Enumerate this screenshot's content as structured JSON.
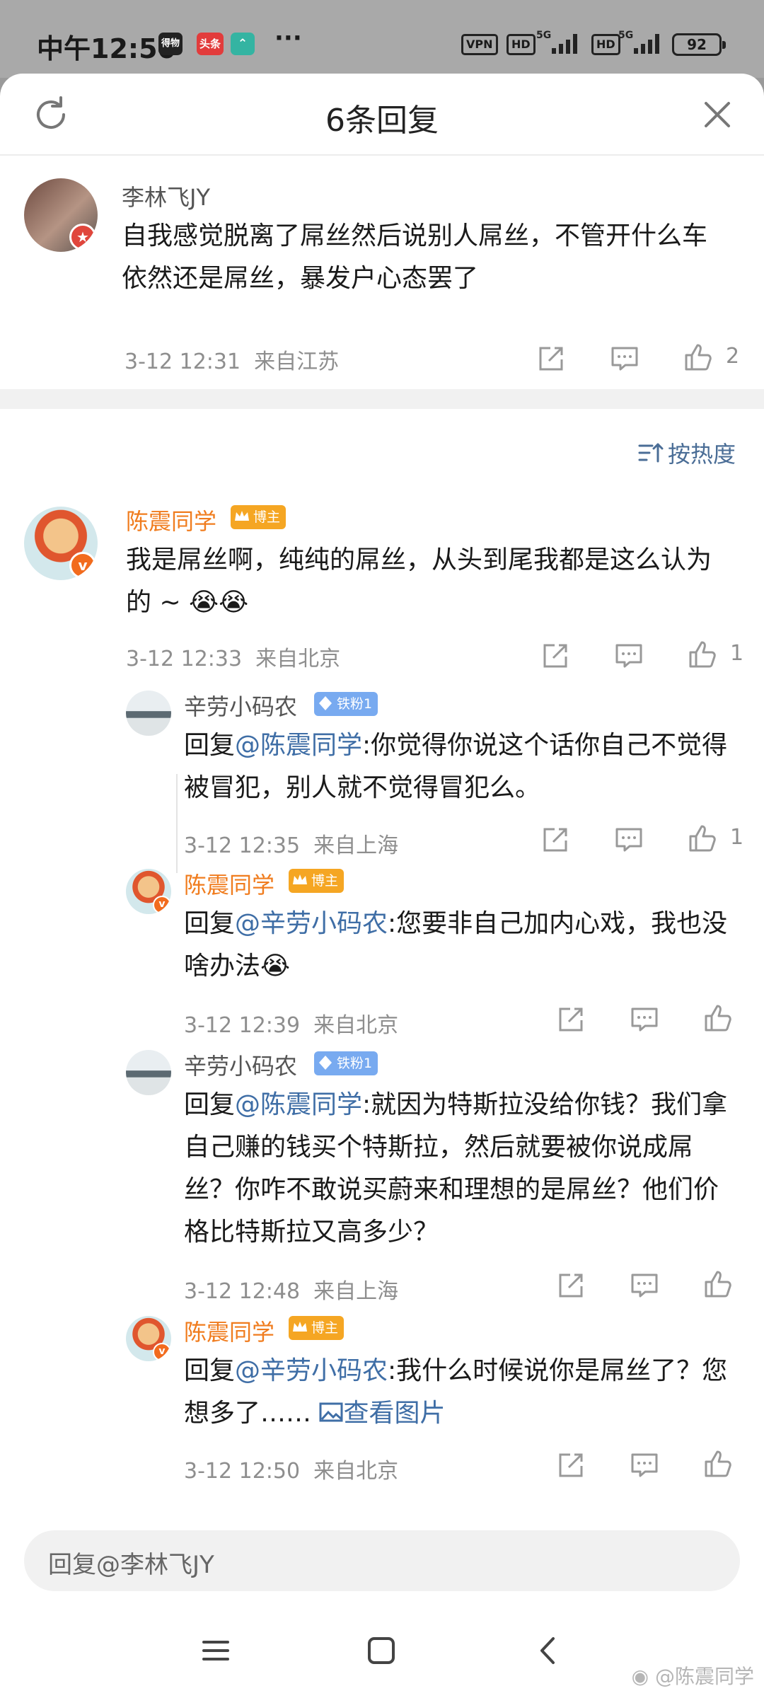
{
  "status_bar": {
    "time": "中午12:50",
    "apps": [
      "得物",
      "头条",
      "⌃"
    ],
    "more": "···",
    "vpn": "VPN",
    "hd": "HD",
    "net": "5G",
    "battery": "92"
  },
  "header": {
    "title": "6条回复"
  },
  "root_comment": {
    "user": "李林飞JY",
    "text": "自我感觉脱离了屌丝然后说别人屌丝，不管开什么车依然还是屌丝，暴发户心态罢了",
    "time": "3-12 12:31",
    "location": "来自江苏",
    "likes": "2"
  },
  "sort": {
    "label": "按热度"
  },
  "main_comment": {
    "user": "陈震同学",
    "badge": "博主",
    "text": "我是屌丝啊，纯纯的屌丝，从头到尾我都是这么认为的 ~ 😭😭",
    "time": "3-12 12:33",
    "location": "来自北京",
    "likes": "1"
  },
  "replies": [
    {
      "user": "辛劳小码农",
      "badge": "铁粉1",
      "prefix": "回复",
      "mention": "@陈震同学",
      "text": ":你觉得你说这个话你自己不觉得被冒犯，别人就不觉得冒犯么。",
      "time": "3-12 12:35",
      "location": "来自上海",
      "likes": "1"
    },
    {
      "user": "陈震同学",
      "badge": "博主",
      "prefix": "回复",
      "mention": "@辛劳小码农",
      "text": ":您要非自己加内心戏，我也没啥办法😭",
      "time": "3-12 12:39",
      "location": "来自北京",
      "likes": ""
    },
    {
      "user": "辛劳小码农",
      "badge": "铁粉1",
      "prefix": "回复",
      "mention": "@陈震同学",
      "text": ":就因为特斯拉没给你钱？我们拿自己赚的钱买个特斯拉，然后就要被你说成屌丝？你咋不敢说买蔚来和理想的是屌丝？他们价格比特斯拉又高多少？",
      "time": "3-12 12:48",
      "location": "来自上海",
      "likes": ""
    },
    {
      "user": "陈震同学",
      "badge": "博主",
      "prefix": "回复",
      "mention": "@辛劳小码农",
      "text": ":我什么时候说你是屌丝了？您想多了……",
      "link": "查看图片",
      "time": "3-12 12:50",
      "location": "来自北京",
      "likes": ""
    }
  ],
  "reply_box": {
    "placeholder": "回复@李林飞JY"
  },
  "watermark": "@陈震同学",
  "colors": {
    "orange_name": "#f07c1e",
    "mention_blue": "#3f6ea6",
    "host_badge": "#f5a623",
    "fan_badge": "#78aaf0",
    "verified_badge": "#f26b1d"
  }
}
